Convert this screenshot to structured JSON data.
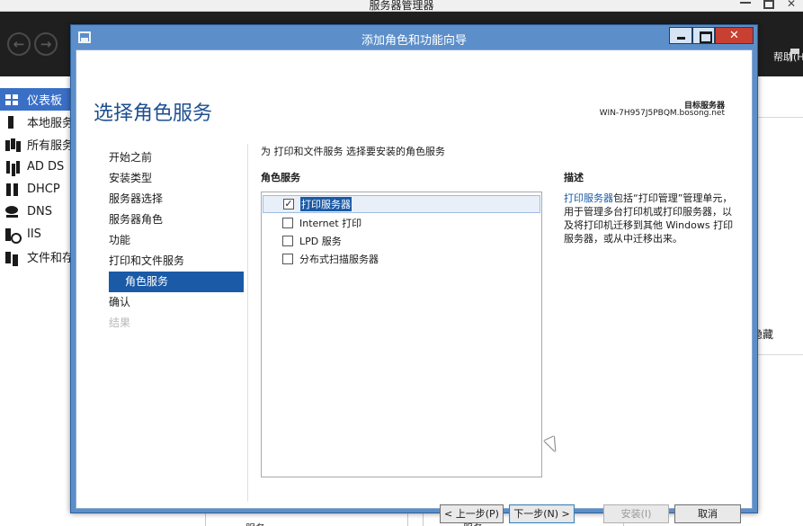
{
  "background_app": {
    "title": "服务器管理器",
    "help_menu": "帮助(H",
    "nav_items": [
      {
        "label": "仪表板",
        "icon": "dashboard-icon",
        "active": true
      },
      {
        "label": "本地服务",
        "icon": "local-server-icon"
      },
      {
        "label": "所有服务",
        "icon": "all-servers-icon"
      },
      {
        "label": "AD DS",
        "icon": "ad-ds-icon"
      },
      {
        "label": "DHCP",
        "icon": "dhcp-icon"
      },
      {
        "label": "DNS",
        "icon": "dns-icon"
      },
      {
        "label": "IIS",
        "icon": "iis-icon"
      },
      {
        "label": "文件和存",
        "icon": "file-storage-icon"
      }
    ],
    "hide_label": "隐藏",
    "bottom_labels": [
      "服务",
      "服务"
    ]
  },
  "wizard": {
    "title": "添加角色和功能向导",
    "heading": "选择角色服务",
    "destination": {
      "label": "目标服务器",
      "name": "WIN-7H957J5PBQM.bosong.net"
    },
    "steps": [
      {
        "label": "开始之前",
        "state": "normal"
      },
      {
        "label": "安装类型",
        "state": "normal"
      },
      {
        "label": "服务器选择",
        "state": "normal"
      },
      {
        "label": "服务器角色",
        "state": "normal"
      },
      {
        "label": "功能",
        "state": "normal"
      },
      {
        "label": "打印和文件服务",
        "state": "normal"
      },
      {
        "label": "角色服务",
        "state": "current"
      },
      {
        "label": "确认",
        "state": "normal"
      },
      {
        "label": "结果",
        "state": "disabled"
      }
    ],
    "instruction": "为 打印和文件服务 选择要安装的角色服务",
    "role_services_header": "角色服务",
    "role_services": [
      {
        "label": "打印服务器",
        "checked": true,
        "selected": true
      },
      {
        "label": "Internet 打印",
        "checked": false
      },
      {
        "label": "LPD 服务",
        "checked": false
      },
      {
        "label": "分布式扫描服务器",
        "checked": false
      }
    ],
    "description_header": "描述",
    "description_link": "打印服务器",
    "description_text": "包括“打印管理”管理单元，用于管理多台打印机或打印服务器，以及将打印机迁移到其他 Windows 打印服务器，或从中迁移出来。",
    "buttons": {
      "prev": "< 上一步(P)",
      "next": "下一步(N) >",
      "install": "安装(I)",
      "cancel": "取消"
    }
  },
  "colors": {
    "wizard_frame": "#5c8fc9",
    "heading": "#1d4f91",
    "selection": "#1b5aa6",
    "close_button": "#c84031",
    "nav_active": "#3a6fc6",
    "header_bg": "#1f1f1f"
  }
}
